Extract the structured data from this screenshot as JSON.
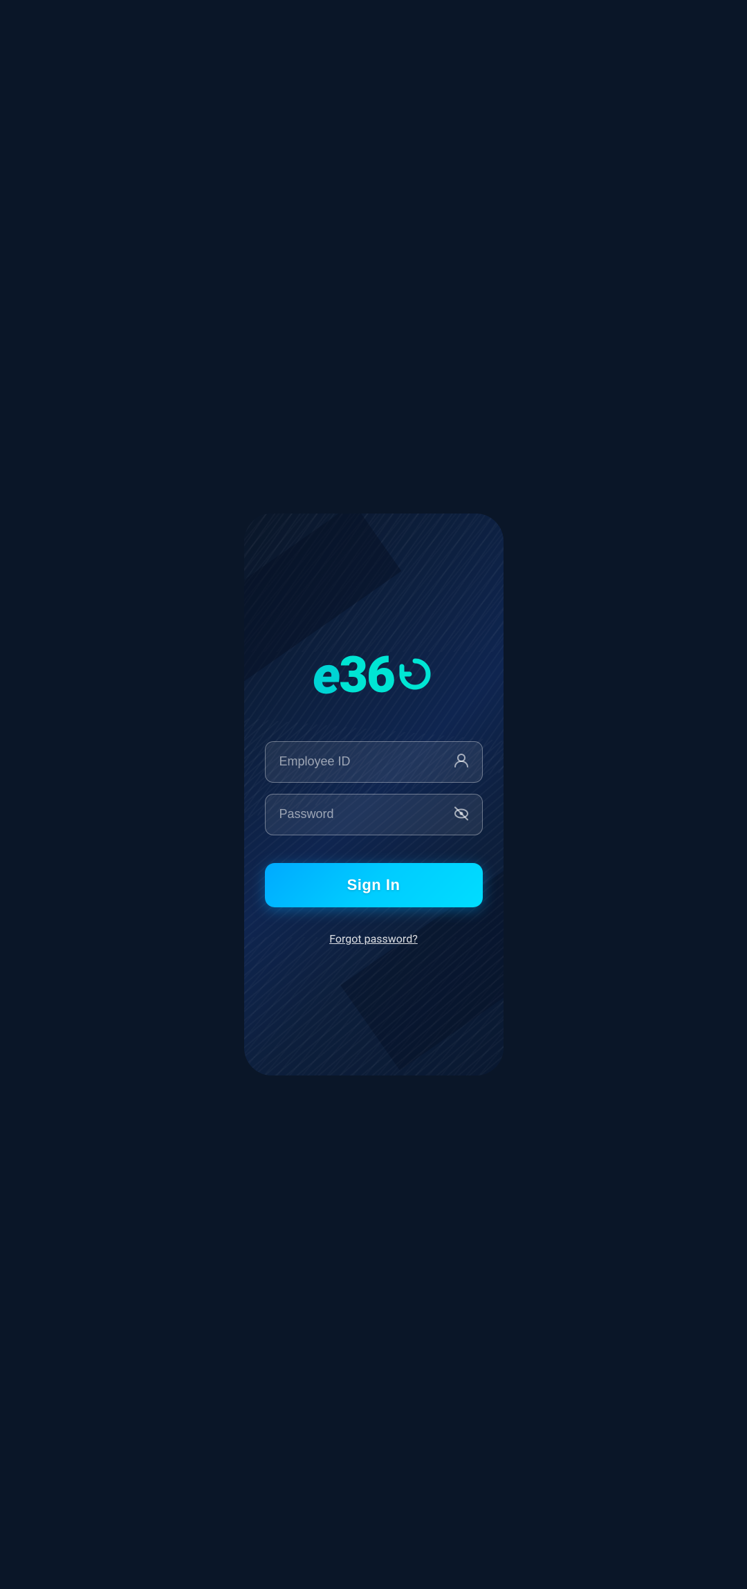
{
  "app": {
    "name": "e360",
    "background_color": "#0d1f3c",
    "accent_color": "#00ccff",
    "brand_color": "#00e5d4"
  },
  "logo": {
    "prefix": "e",
    "number": "36",
    "suffix_icon": "cycle-icon"
  },
  "form": {
    "employee_id_placeholder": "Employee ID",
    "password_placeholder": "Password",
    "signin_label": "Sign In",
    "forgot_password_label": "Forgot password?"
  },
  "icons": {
    "user_icon": "👤",
    "eye_off_icon": "🙈"
  }
}
